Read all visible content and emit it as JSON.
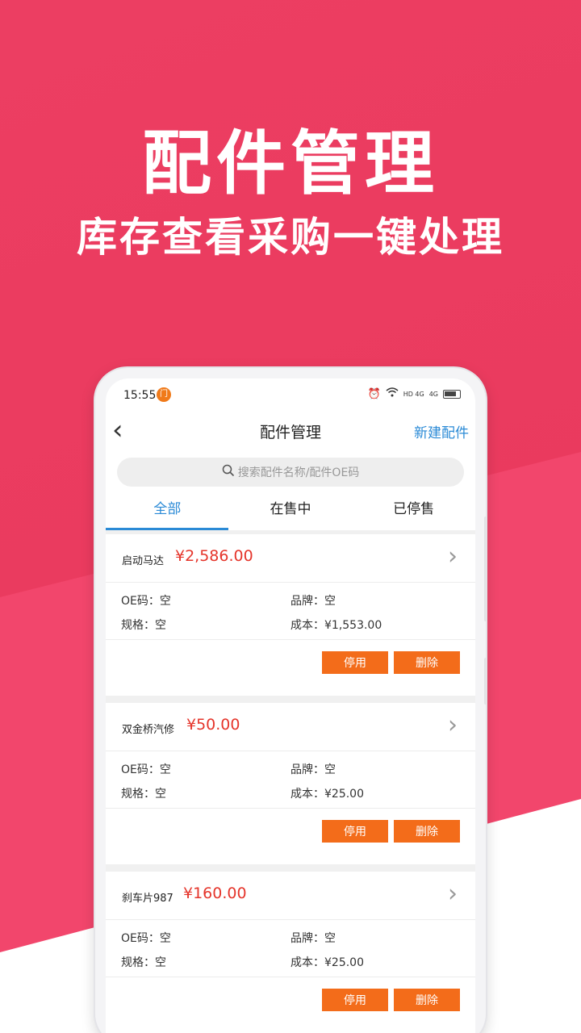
{
  "promo": {
    "headline": "配件管理",
    "subline": "库存查看采购一键处理"
  },
  "statusbar": {
    "time": "15:55",
    "app_badge": "门",
    "alarm_icon": "alarm-icon",
    "wifi_icon": "wifi-icon",
    "signal1": "HD 4G",
    "signal2": "4G"
  },
  "navbar": {
    "back": "‹",
    "title": "配件管理",
    "new_label": "新建配件"
  },
  "search": {
    "placeholder": "搜索配件名称/配件OE码"
  },
  "tabs": [
    {
      "label": "全部",
      "active": true
    },
    {
      "label": "在售中",
      "active": false
    },
    {
      "label": "已停售",
      "active": false
    }
  ],
  "labels": {
    "oe": "OE码：",
    "brand": "品牌：",
    "spec": "规格：",
    "cost": "成本：",
    "disable": "停用",
    "delete": "删除"
  },
  "items": [
    {
      "name": "启动马达",
      "price": "¥2,586.00",
      "oe": "空",
      "brand": "空",
      "spec": "空",
      "cost": "¥1,553.00"
    },
    {
      "name": "双金桥汽修",
      "price": "¥50.00",
      "oe": "空",
      "brand": "空",
      "spec": "空",
      "cost": "¥25.00"
    },
    {
      "name": "刹车片987",
      "price": "¥160.00",
      "oe": "空",
      "brand": "空",
      "spec": "空",
      "cost": "¥25.00"
    }
  ],
  "colors": {
    "brand_red": "#e93a5f",
    "accent_blue": "#2a8ad6",
    "price_red": "#e5352b",
    "button_orange": "#f36c1a"
  }
}
